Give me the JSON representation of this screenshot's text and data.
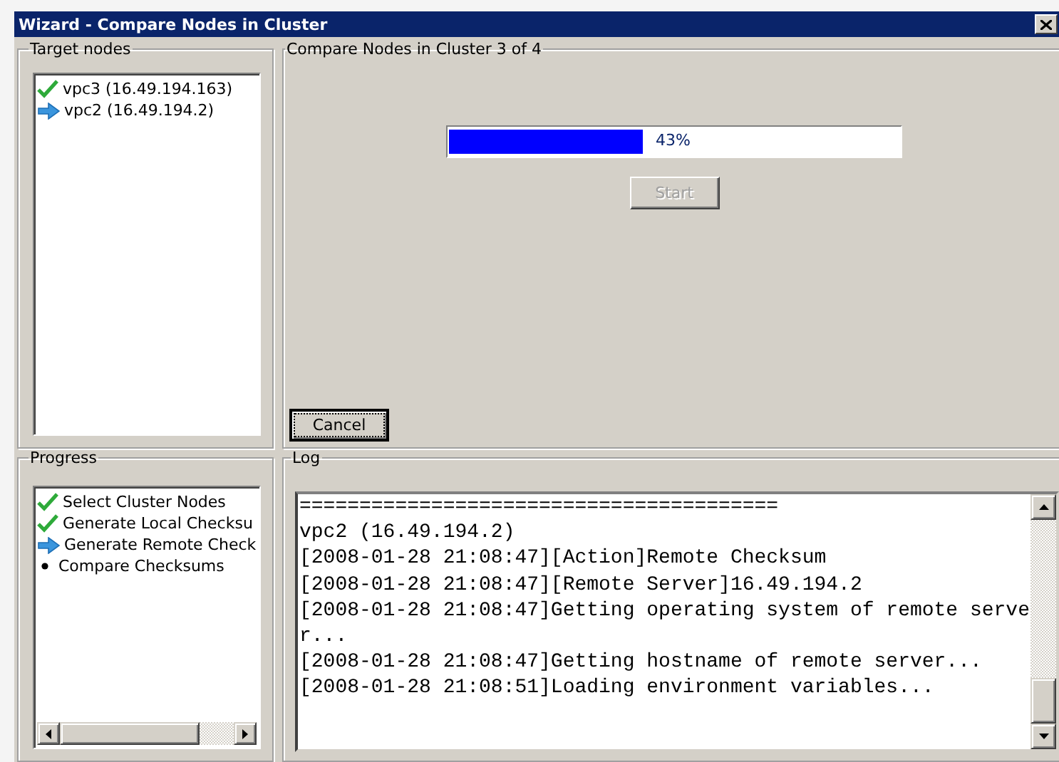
{
  "window": {
    "title": "Wizard - Compare Nodes in Cluster"
  },
  "target_nodes": {
    "title": "Target nodes",
    "items": [
      {
        "kind": "done",
        "label": "vpc3 (16.49.194.163)"
      },
      {
        "kind": "current",
        "label": "vpc2 (16.49.194.2)"
      }
    ]
  },
  "compare": {
    "title": "Compare Nodes in Cluster 3 of 4",
    "progress": {
      "level": 0.43,
      "reading": "43%"
    },
    "start_button": {
      "label": "Start",
      "disabled": true
    },
    "cancel_button": {
      "label": "Cancel",
      "disabled": false
    }
  },
  "progress": {
    "title": "Progress",
    "items": [
      {
        "kind": "done",
        "label": "Select Cluster Nodes"
      },
      {
        "kind": "done",
        "label": "Generate Local Checksu"
      },
      {
        "kind": "current",
        "label": "Generate Remote Check"
      },
      {
        "kind": "pending",
        "label": "Compare Checksums"
      }
    ]
  },
  "log": {
    "title": "Log",
    "lines": [
      "========================================",
      "vpc2 (16.49.194.2)",
      "[2008-01-28 21:08:47][Action]Remote Checksum",
      "[2008-01-28 21:08:47][Remote Server]16.49.194.2",
      "[2008-01-28 21:08:47]Getting operating system of remote server...",
      "[2008-01-28 21:08:47]Getting hostname of remote server...",
      "[2008-01-28 21:08:51]Loading environment variables..."
    ]
  }
}
